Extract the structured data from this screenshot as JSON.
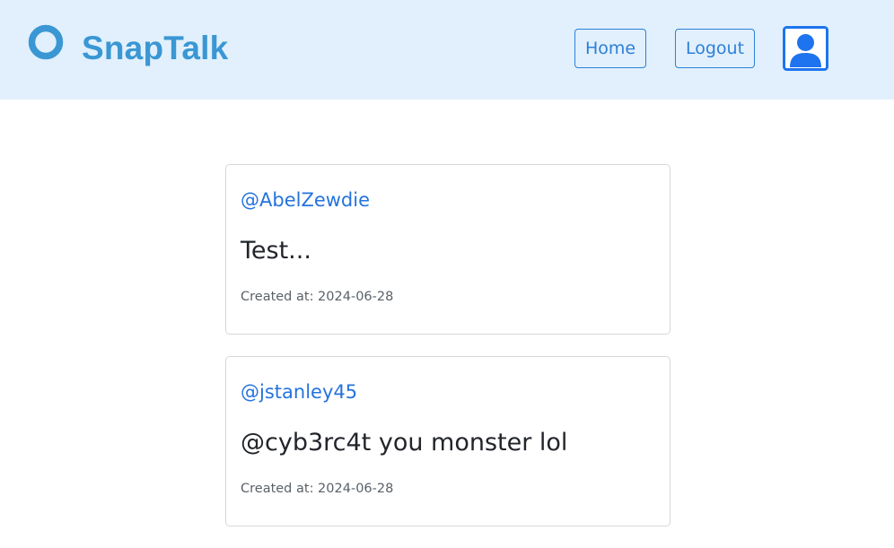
{
  "navbar": {
    "brand": "SnapTalk",
    "logo_icon": "ring-logo-icon",
    "home_label": "Home",
    "logout_label": "Logout",
    "avatar_icon": "person-icon",
    "colors": {
      "background": "#e1f0fc",
      "brand": "#3a97d4",
      "button": "#2d7fd8"
    }
  },
  "posts": [
    {
      "username": "@AbelZewdie",
      "content": "Test...",
      "created": "Created at: 2024-06-28"
    },
    {
      "username": "@jstanley45",
      "content": "@cyb3rc4t you monster lol",
      "created": "Created at: 2024-06-28"
    }
  ]
}
